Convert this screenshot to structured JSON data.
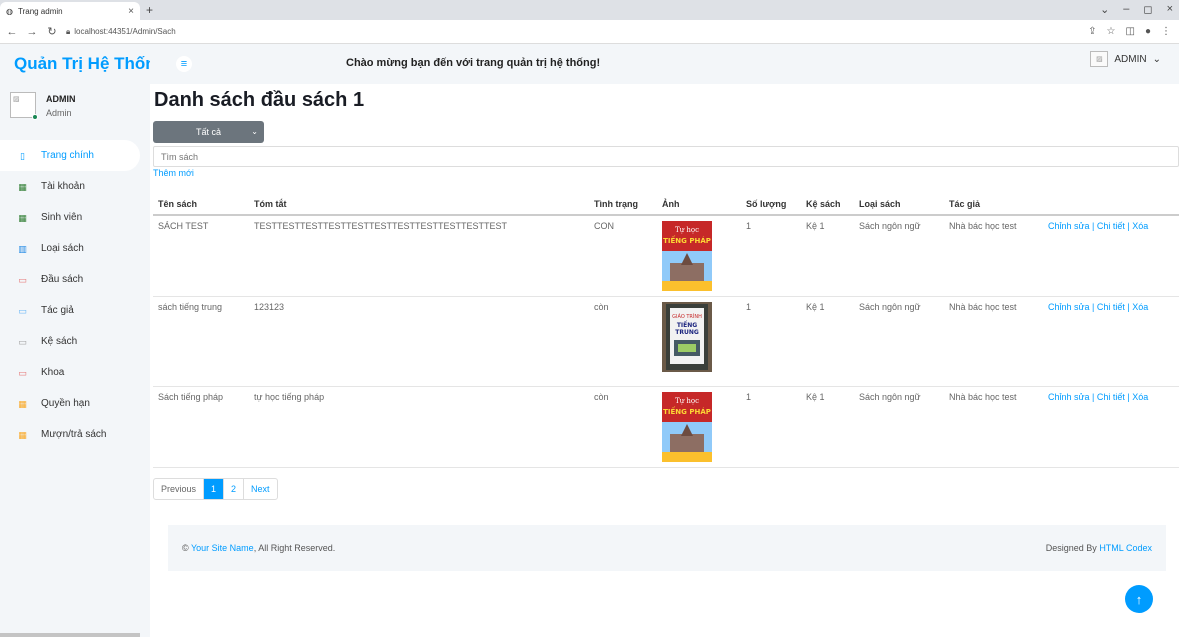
{
  "browser": {
    "tab_title": "Trang admin",
    "tab_close": "×",
    "new_tab": "+",
    "url": "localhost:44351/Admin/Sach",
    "win_min": "–",
    "win_max": "◻",
    "win_close": "×"
  },
  "brand": "Quản Trị Hệ Thống",
  "topbar": {
    "welcome": "Chào mừng bạn đến với trang quản trị hệ thống!",
    "user_label": "ADMIN",
    "user_caret": "⌄"
  },
  "profile": {
    "name": "ADMIN",
    "role": "Admin"
  },
  "sidebar": {
    "items": [
      {
        "label": "Trang chính",
        "icon": "home-icon",
        "active": true
      },
      {
        "label": "Tài khoản",
        "icon": "grid-icon",
        "active": false
      },
      {
        "label": "Sinh viên",
        "icon": "grid-icon",
        "active": false
      },
      {
        "label": "Loại sách",
        "icon": "bar-chart-icon",
        "active": false
      },
      {
        "label": "Đầu sách",
        "icon": "book-icon",
        "active": false
      },
      {
        "label": "Tác giả",
        "icon": "book-icon",
        "active": false
      },
      {
        "label": "Kệ sách",
        "icon": "book-icon",
        "active": false
      },
      {
        "label": "Khoa",
        "icon": "book-icon",
        "active": false
      },
      {
        "label": "Quyền hạn",
        "icon": "table-icon",
        "active": false
      },
      {
        "label": "Mượn/trả sách",
        "icon": "table-icon",
        "active": false
      }
    ]
  },
  "main": {
    "title": "Danh sách đầu sách 1",
    "filter_selected": "Tất cả",
    "search_placeholder": "Tìm sách",
    "add_new": "Thêm mới",
    "columns": [
      "Tên sách",
      "Tóm tắt",
      "Tình trạng",
      "Ảnh",
      "Số lượng",
      "Kệ sách",
      "Loại sách",
      "Tác giả",
      ""
    ],
    "rows": [
      {
        "ten": "SÁCH TEST",
        "tomtat": "TESTTESTTESTTESTTESTTESTTESTTESTTESTTESTTEST",
        "tinhtrang": "CON",
        "soluong": "1",
        "kesach": "Kệ 1",
        "loaisach": "Sách ngôn ngữ",
        "tacgia": "Nhà bác học test",
        "edit": "Chỉnh sửa",
        "detail": "Chi tiết",
        "delete": "Xóa",
        "cover": "phap"
      },
      {
        "ten": "sách tiếng trung",
        "tomtat": "123123",
        "tinhtrang": "còn",
        "soluong": "1",
        "kesach": "Kệ 1",
        "loaisach": "Sách ngôn ngữ",
        "tacgia": "Nhà bác học test",
        "edit": "Chỉnh sửa",
        "detail": "Chi tiết",
        "delete": "Xóa",
        "cover": "trung"
      },
      {
        "ten": "Sách tiếng pháp",
        "tomtat": "tự học tiếng pháp",
        "tinhtrang": "còn",
        "soluong": "1",
        "kesach": "Kệ 1",
        "loaisach": "Sách ngôn ngữ",
        "tacgia": "Nhà bác học test",
        "edit": "Chỉnh sửa",
        "detail": "Chi tiết",
        "delete": "Xóa",
        "cover": "phap"
      }
    ],
    "pagination": {
      "previous": "Previous",
      "pages": [
        "1",
        "2"
      ],
      "current": "1",
      "next": "Next"
    }
  },
  "footer": {
    "copyright_prefix": "©",
    "site_name": "Your Site Name",
    "rights": ", All Right Reserved.",
    "designed_by": "Designed By",
    "designer": "HTML Codex"
  },
  "back_to_top": "↑",
  "colors": {
    "primary": "#009cff",
    "sidebar_bg": "#f3f6f9",
    "select_bg": "#6c757d"
  }
}
